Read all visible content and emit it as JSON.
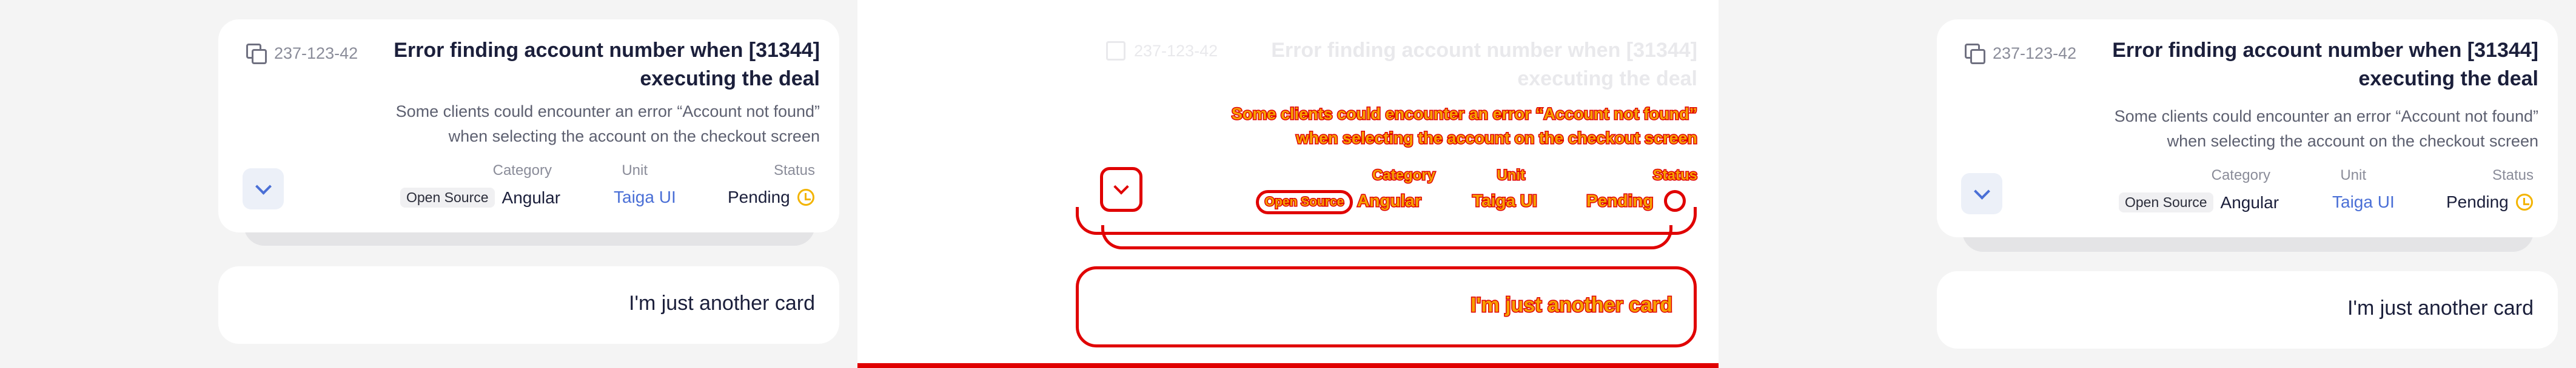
{
  "card": {
    "id": "237-123-42",
    "title_line1": "Error finding account number when [31344]",
    "title_line2": "executing the deal",
    "desc_line1": "Some clients could encounter an error “Account not found”",
    "desc_line2": "when selecting the account on the checkout screen",
    "category_label": "Category",
    "category_chip": "Open Source",
    "category_value": "Angular",
    "unit_label": "Unit",
    "unit_value": "Taiga UI",
    "status_label": "Status",
    "status_value": "Pending"
  },
  "another_card_text": "I'm just another card",
  "colors": {
    "accent": "#4a6fd6",
    "pending": "#f3b400",
    "outline": "#e00000",
    "outline_fill": "#f6a000"
  },
  "icons": [
    "copy-icon",
    "chevron-down-icon",
    "pending-clock-icon"
  ]
}
